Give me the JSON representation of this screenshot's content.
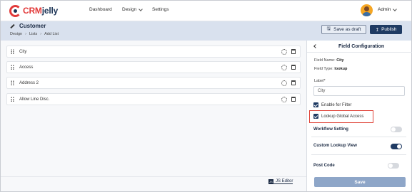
{
  "brand": {
    "crm": "CRM",
    "jelly": "jelly"
  },
  "nav": {
    "dashboard": "Dashboard",
    "design": "Design",
    "settings": "Settings"
  },
  "user": {
    "name": "Admin"
  },
  "page": {
    "title": "Customer",
    "breadcrumb": [
      "Design",
      "Lists",
      "Add List"
    ],
    "save_draft_label": "Save as draft",
    "publish_label": "Publish"
  },
  "fields": [
    {
      "label": "City"
    },
    {
      "label": "Access"
    },
    {
      "label": "Address 2"
    },
    {
      "label": "Allow Line Disc."
    }
  ],
  "js_editor": {
    "label": "JS Editor",
    "icon": "JS"
  },
  "panel": {
    "title": "Field Configuration",
    "field_name_label": "Field Name:",
    "field_name_value": "City",
    "field_type_label": "Field Type:",
    "field_type_value": "lookup",
    "label_caption": "Label*",
    "label_value": "City",
    "enable_filter": {
      "label": "Enable for Filter",
      "checked": true
    },
    "lookup_global": {
      "label": "Lookup Global Access",
      "checked": true
    },
    "workflow_setting": {
      "label": "Workflow Setting",
      "on": false
    },
    "custom_lookup_view": {
      "label": "Custom Lookup View",
      "on": true
    },
    "post_code": {
      "label": "Post Code",
      "on": false
    },
    "save_label": "Save"
  },
  "colors": {
    "primary": "#1f3b63",
    "accent": "#e23a3a",
    "highlight": "#e0453a",
    "subheader": "#d9e1ee"
  }
}
